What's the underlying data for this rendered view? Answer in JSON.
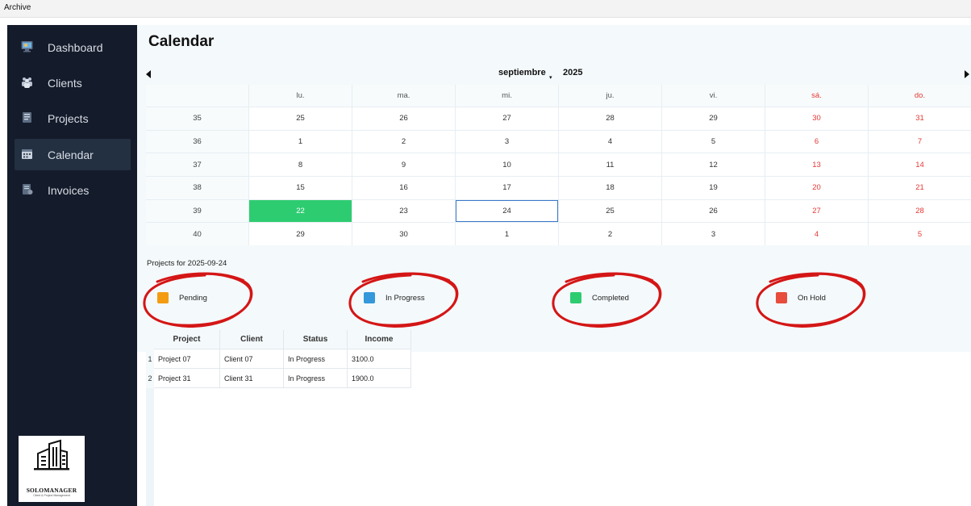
{
  "menubar": {
    "archive_label": "Archive"
  },
  "sidebar": {
    "items": [
      {
        "label": "Dashboard",
        "icon": "dashboard-icon"
      },
      {
        "label": "Clients",
        "icon": "clients-icon"
      },
      {
        "label": "Projects",
        "icon": "projects-icon"
      },
      {
        "label": "Calendar",
        "icon": "calendar-icon",
        "active": true
      },
      {
        "label": "Invoices",
        "icon": "invoices-icon"
      }
    ],
    "logo_text": "SOLOMANAGER",
    "logo_subtext": "Client & Project Management"
  },
  "page": {
    "title": "Calendar"
  },
  "calendar": {
    "month": "septiembre",
    "year": "2025",
    "weekday_headers": [
      "",
      "lu.",
      "ma.",
      "mi.",
      "ju.",
      "vi.",
      "sá.",
      "do."
    ],
    "weeks": [
      {
        "week": "35",
        "days": [
          "25",
          "26",
          "27",
          "28",
          "29",
          "30",
          "31"
        ]
      },
      {
        "week": "36",
        "days": [
          "1",
          "2",
          "3",
          "4",
          "5",
          "6",
          "7"
        ]
      },
      {
        "week": "37",
        "days": [
          "8",
          "9",
          "10",
          "11",
          "12",
          "13",
          "14"
        ]
      },
      {
        "week": "38",
        "days": [
          "15",
          "16",
          "17",
          "18",
          "19",
          "20",
          "21"
        ]
      },
      {
        "week": "39",
        "days": [
          "22",
          "23",
          "24",
          "25",
          "26",
          "27",
          "28"
        ]
      },
      {
        "week": "40",
        "days": [
          "29",
          "30",
          "1",
          "2",
          "3",
          "4",
          "5"
        ]
      }
    ],
    "highlighted_day": "22",
    "selected_day": "24",
    "weekend_color": "#e53935",
    "highlight_color": "#2ecc71",
    "selection_color": "#3a78c9"
  },
  "projects_caption": "Projects for 2025-09-24",
  "legend": [
    {
      "label": "Pending",
      "color": "#f39c12"
    },
    {
      "label": "In Progress",
      "color": "#3498db"
    },
    {
      "label": "Completed",
      "color": "#2ecc71"
    },
    {
      "label": "On Hold",
      "color": "#e74c3c"
    }
  ],
  "annotation_color": "#d41616",
  "table": {
    "headers": [
      "Project",
      "Client",
      "Status",
      "Income"
    ],
    "rows": [
      {
        "index": "1",
        "cells": [
          "Project 07",
          "Client 07",
          "In Progress",
          "3100.0"
        ]
      },
      {
        "index": "2",
        "cells": [
          "Project 31",
          "Client 31",
          "In Progress",
          "1900.0"
        ]
      }
    ]
  }
}
